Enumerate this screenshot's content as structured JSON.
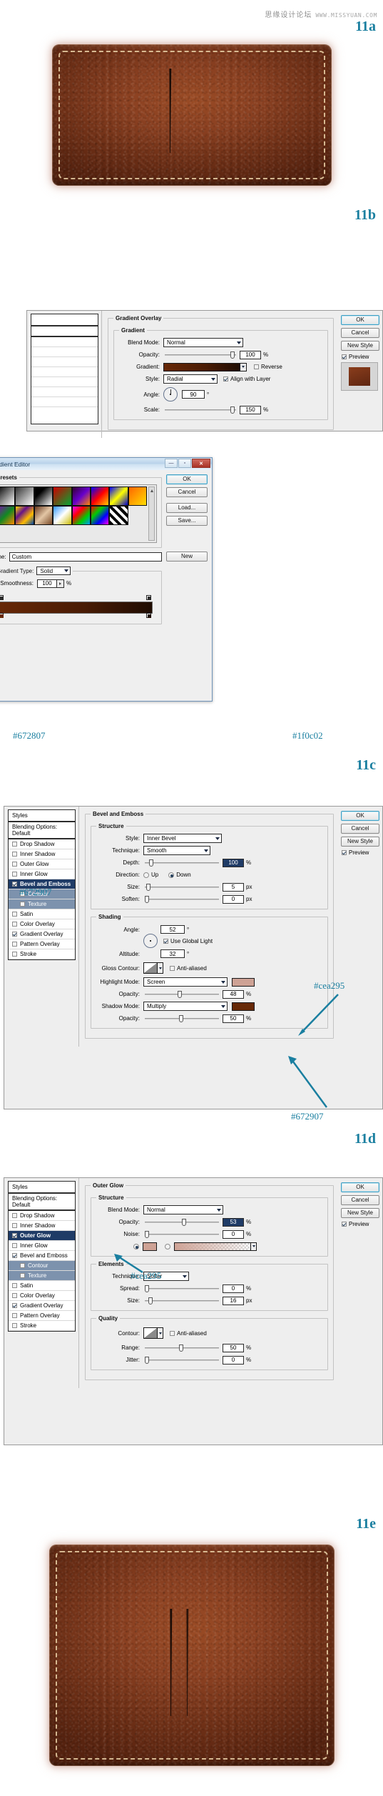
{
  "watermark": {
    "cn": "思缘设计论坛",
    "url": "WWW.MISSYUAN.COM"
  },
  "steps": {
    "a": "11a",
    "b": "11b",
    "c": "11c",
    "d": "11d",
    "e": "11e"
  },
  "gradient_overlay": {
    "group_title": "Gradient Overlay",
    "section_title": "Gradient",
    "blend_mode_label": "Blend Mode:",
    "blend_mode_value": "Normal",
    "opacity_label": "Opacity:",
    "opacity_value": "100",
    "opacity_unit": "%",
    "gradient_label": "Gradient:",
    "reverse_label": "Reverse",
    "style_label": "Style:",
    "style_value": "Radial",
    "align_label": "Align with Layer",
    "angle_label": "Angle:",
    "angle_value": "90",
    "angle_unit": "°",
    "scale_label": "Scale:",
    "scale_value": "150",
    "scale_unit": "%",
    "buttons": {
      "ok": "OK",
      "cancel": "Cancel",
      "new_style": "New Style",
      "preview": "Preview"
    }
  },
  "gradient_editor": {
    "title": "Gradient Editor",
    "presets_label": "Presets",
    "name_label": "Name:",
    "name_value": "Custom",
    "new_button": "New",
    "gradient_type_label": "Gradient Type:",
    "gradient_type_value": "Solid",
    "smoothness_label": "Smoothness:",
    "smoothness_value": "100",
    "smoothness_unit": "%",
    "buttons": {
      "ok": "OK",
      "cancel": "Cancel",
      "load": "Load...",
      "save": "Save..."
    },
    "stop_left_hex": "#672807",
    "stop_right_hex": "#1f0c02"
  },
  "styles_list": {
    "header": "Styles",
    "blending_options": "Blending Options: Default",
    "items_c": [
      {
        "label": "Drop Shadow",
        "checked": false,
        "sub": false,
        "selected": false
      },
      {
        "label": "Inner Shadow",
        "checked": false,
        "sub": false,
        "selected": false
      },
      {
        "label": "Outer Glow",
        "checked": false,
        "sub": false,
        "selected": false
      },
      {
        "label": "Inner Glow",
        "checked": false,
        "sub": false,
        "selected": false
      },
      {
        "label": "Bevel and Emboss",
        "checked": true,
        "sub": false,
        "selected": true
      },
      {
        "label": "Contour",
        "checked": false,
        "sub": true,
        "selected": false
      },
      {
        "label": "Texture",
        "checked": false,
        "sub": true,
        "selected": false
      },
      {
        "label": "Satin",
        "checked": false,
        "sub": false,
        "selected": false
      },
      {
        "label": "Color Overlay",
        "checked": false,
        "sub": false,
        "selected": false
      },
      {
        "label": "Gradient Overlay",
        "checked": true,
        "sub": false,
        "selected": false
      },
      {
        "label": "Pattern Overlay",
        "checked": false,
        "sub": false,
        "selected": false
      },
      {
        "label": "Stroke",
        "checked": false,
        "sub": false,
        "selected": false
      }
    ],
    "items_d": [
      {
        "label": "Drop Shadow",
        "checked": false,
        "sub": false,
        "selected": false
      },
      {
        "label": "Inner Shadow",
        "checked": false,
        "sub": false,
        "selected": false
      },
      {
        "label": "Outer Glow",
        "checked": true,
        "sub": false,
        "selected": true
      },
      {
        "label": "Inner Glow",
        "checked": false,
        "sub": false,
        "selected": false
      },
      {
        "label": "Bevel and Emboss",
        "checked": true,
        "sub": false,
        "selected": false
      },
      {
        "label": "Contour",
        "checked": false,
        "sub": true,
        "selected": false
      },
      {
        "label": "Texture",
        "checked": false,
        "sub": true,
        "selected": false
      },
      {
        "label": "Satin",
        "checked": false,
        "sub": false,
        "selected": false
      },
      {
        "label": "Color Overlay",
        "checked": false,
        "sub": false,
        "selected": false
      },
      {
        "label": "Gradient Overlay",
        "checked": true,
        "sub": false,
        "selected": false
      },
      {
        "label": "Pattern Overlay",
        "checked": false,
        "sub": false,
        "selected": false
      },
      {
        "label": "Stroke",
        "checked": false,
        "sub": false,
        "selected": false
      }
    ]
  },
  "bevel": {
    "group_title": "Bevel and Emboss",
    "structure_title": "Structure",
    "style_label": "Style:",
    "style_value": "Inner Bevel",
    "technique_label": "Technique:",
    "technique_value": "Smooth",
    "depth_label": "Depth:",
    "depth_value": "100",
    "depth_unit": "%",
    "direction_label": "Direction:",
    "direction_up": "Up",
    "direction_down": "Down",
    "size_label": "Size:",
    "size_value": "5",
    "size_unit": "px",
    "soften_label": "Soften:",
    "soften_value": "0",
    "soften_unit": "px",
    "shading_title": "Shading",
    "angle_label": "Angle:",
    "angle_value": "52",
    "angle_unit": "°",
    "global_light_label": "Use Global Light",
    "altitude_label": "Altitude:",
    "altitude_value": "32",
    "altitude_unit": "°",
    "gloss_contour_label": "Gloss Contour:",
    "antialiased_label": "Anti-aliased",
    "highlight_mode_label": "Highlight Mode:",
    "highlight_mode_value": "Screen",
    "highlight_opacity_label": "Opacity:",
    "highlight_opacity_value": "48",
    "highlight_opacity_unit": "%",
    "shadow_mode_label": "Shadow Mode:",
    "shadow_mode_value": "Multiply",
    "shadow_opacity_label": "Opacity:",
    "shadow_opacity_value": "50",
    "shadow_opacity_unit": "%",
    "highlight_hex": "#cea295",
    "shadow_hex": "#672907",
    "styles_list_hex": "#672907",
    "buttons": {
      "ok": "OK",
      "cancel": "Cancel",
      "new_style": "New Style",
      "preview": "Preview"
    }
  },
  "outer_glow": {
    "group_title": "Outer Glow",
    "structure_title": "Structure",
    "blend_mode_label": "Blend Mode:",
    "blend_mode_value": "Normal",
    "opacity_label": "Opacity:",
    "opacity_value": "53",
    "opacity_unit": "%",
    "noise_label": "Noise:",
    "noise_value": "0",
    "noise_unit": "%",
    "color_hex": "#cea295",
    "elements_title": "Elements",
    "technique_label": "Technique:",
    "technique_value": "Softer",
    "spread_label": "Spread:",
    "spread_value": "0",
    "spread_unit": "%",
    "size_label": "Size:",
    "size_value": "16",
    "size_unit": "px",
    "quality_title": "Quality",
    "contour_label": "Contour:",
    "antialiased_label": "Anti-aliased",
    "range_label": "Range:",
    "range_value": "50",
    "range_unit": "%",
    "jitter_label": "Jitter:",
    "jitter_value": "0",
    "jitter_unit": "%",
    "buttons": {
      "ok": "OK",
      "cancel": "Cancel",
      "new_style": "New Style",
      "preview": "Preview"
    }
  },
  "colors": {
    "accent": "#1a7fa0",
    "leather_light": "#8a4021",
    "leather_dark": "#55220f",
    "glow": "#cea295"
  }
}
